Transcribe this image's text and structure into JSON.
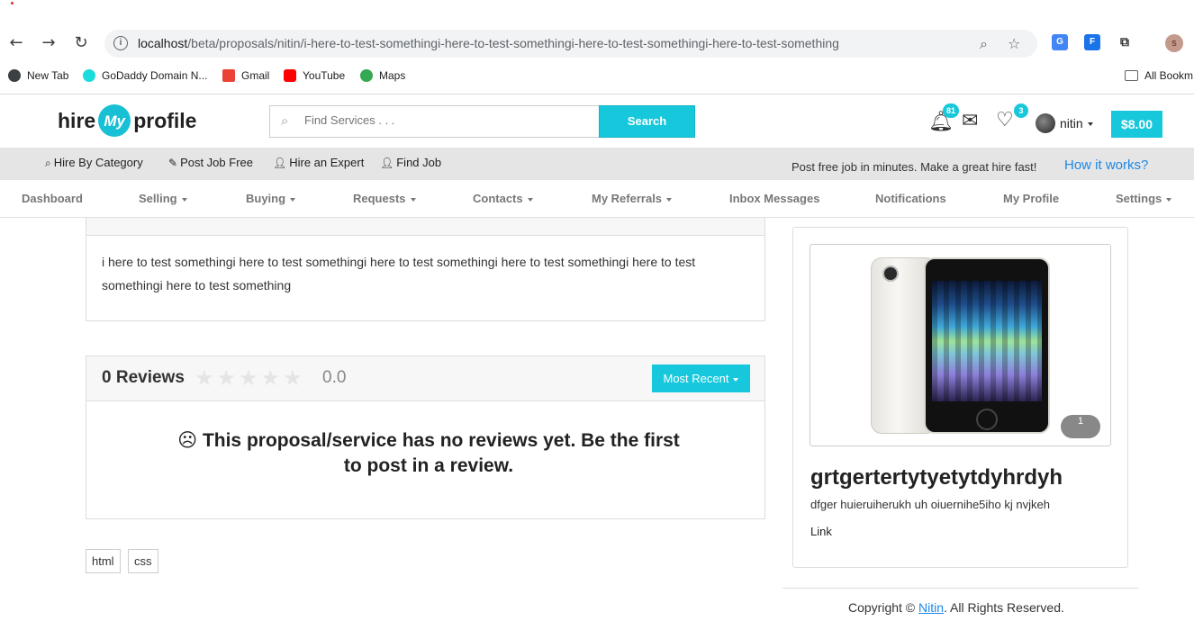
{
  "browser": {
    "url_host": "localhost",
    "url_path": "/beta/proposals/nitin/i-here-to-test-somethingi-here-to-test-somethingi-here-to-test-somethingi-here-to-test-something",
    "profile_initial": "s",
    "bookmarks": [
      {
        "label": "New Tab",
        "icon": "globe-icon"
      },
      {
        "label": "GoDaddy Domain N...",
        "icon": "godaddy-icon"
      },
      {
        "label": "Gmail",
        "icon": "gmail-icon"
      },
      {
        "label": "YouTube",
        "icon": "youtube-icon"
      },
      {
        "label": "Maps",
        "icon": "maps-icon"
      }
    ],
    "all_bookmarks": "All Bookm"
  },
  "header": {
    "logo_left": "hire",
    "logo_mid": "My",
    "logo_right": "profile",
    "search_placeholder": "Find Services . . .",
    "search_button": "Search",
    "notification_count": "81",
    "favorites_count": "3",
    "user_name": "nitin",
    "wallet": "$8.00"
  },
  "sub_bar": {
    "links": [
      "Hire By Category",
      "Post Job Free",
      "Hire an Expert",
      "Find Job"
    ],
    "promo": "Post free job in minutes. Make a great hire fast!",
    "how_it_works": "How it works?"
  },
  "nav": {
    "items": [
      "Dashboard",
      "Selling",
      "Buying",
      "Requests",
      "Contacts",
      "My Referrals",
      "Inbox Messages",
      "Notifications",
      "My Profile",
      "Settings"
    ]
  },
  "proposal": {
    "description": "i here to test somethingi here to test somethingi here to test somethingi here to test somethingi here to test somethingi here to test something"
  },
  "reviews": {
    "title": "0 Reviews",
    "rating": "0.0",
    "stars": "★★★★★",
    "sort_label": "Most Recent",
    "empty_message": "This proposal/service has no reviews yet. Be the first to post in a review.",
    "empty_icon": "☹"
  },
  "tags": [
    "html",
    "css"
  ],
  "sidebar": {
    "image_count": "1",
    "title": "grtgertertytyetytdyhrdyh",
    "subtitle": "dfger huieruiherukh uh oiuernihe5iho kj nvjkeh",
    "link": "Link"
  },
  "footer": {
    "copyright_prefix": "Copyright ©",
    "owner": "Nitin",
    "suffix": ". All Rights Reserved."
  },
  "colors": {
    "accent": "#17c8dc",
    "link_blue": "#1e88e5"
  }
}
